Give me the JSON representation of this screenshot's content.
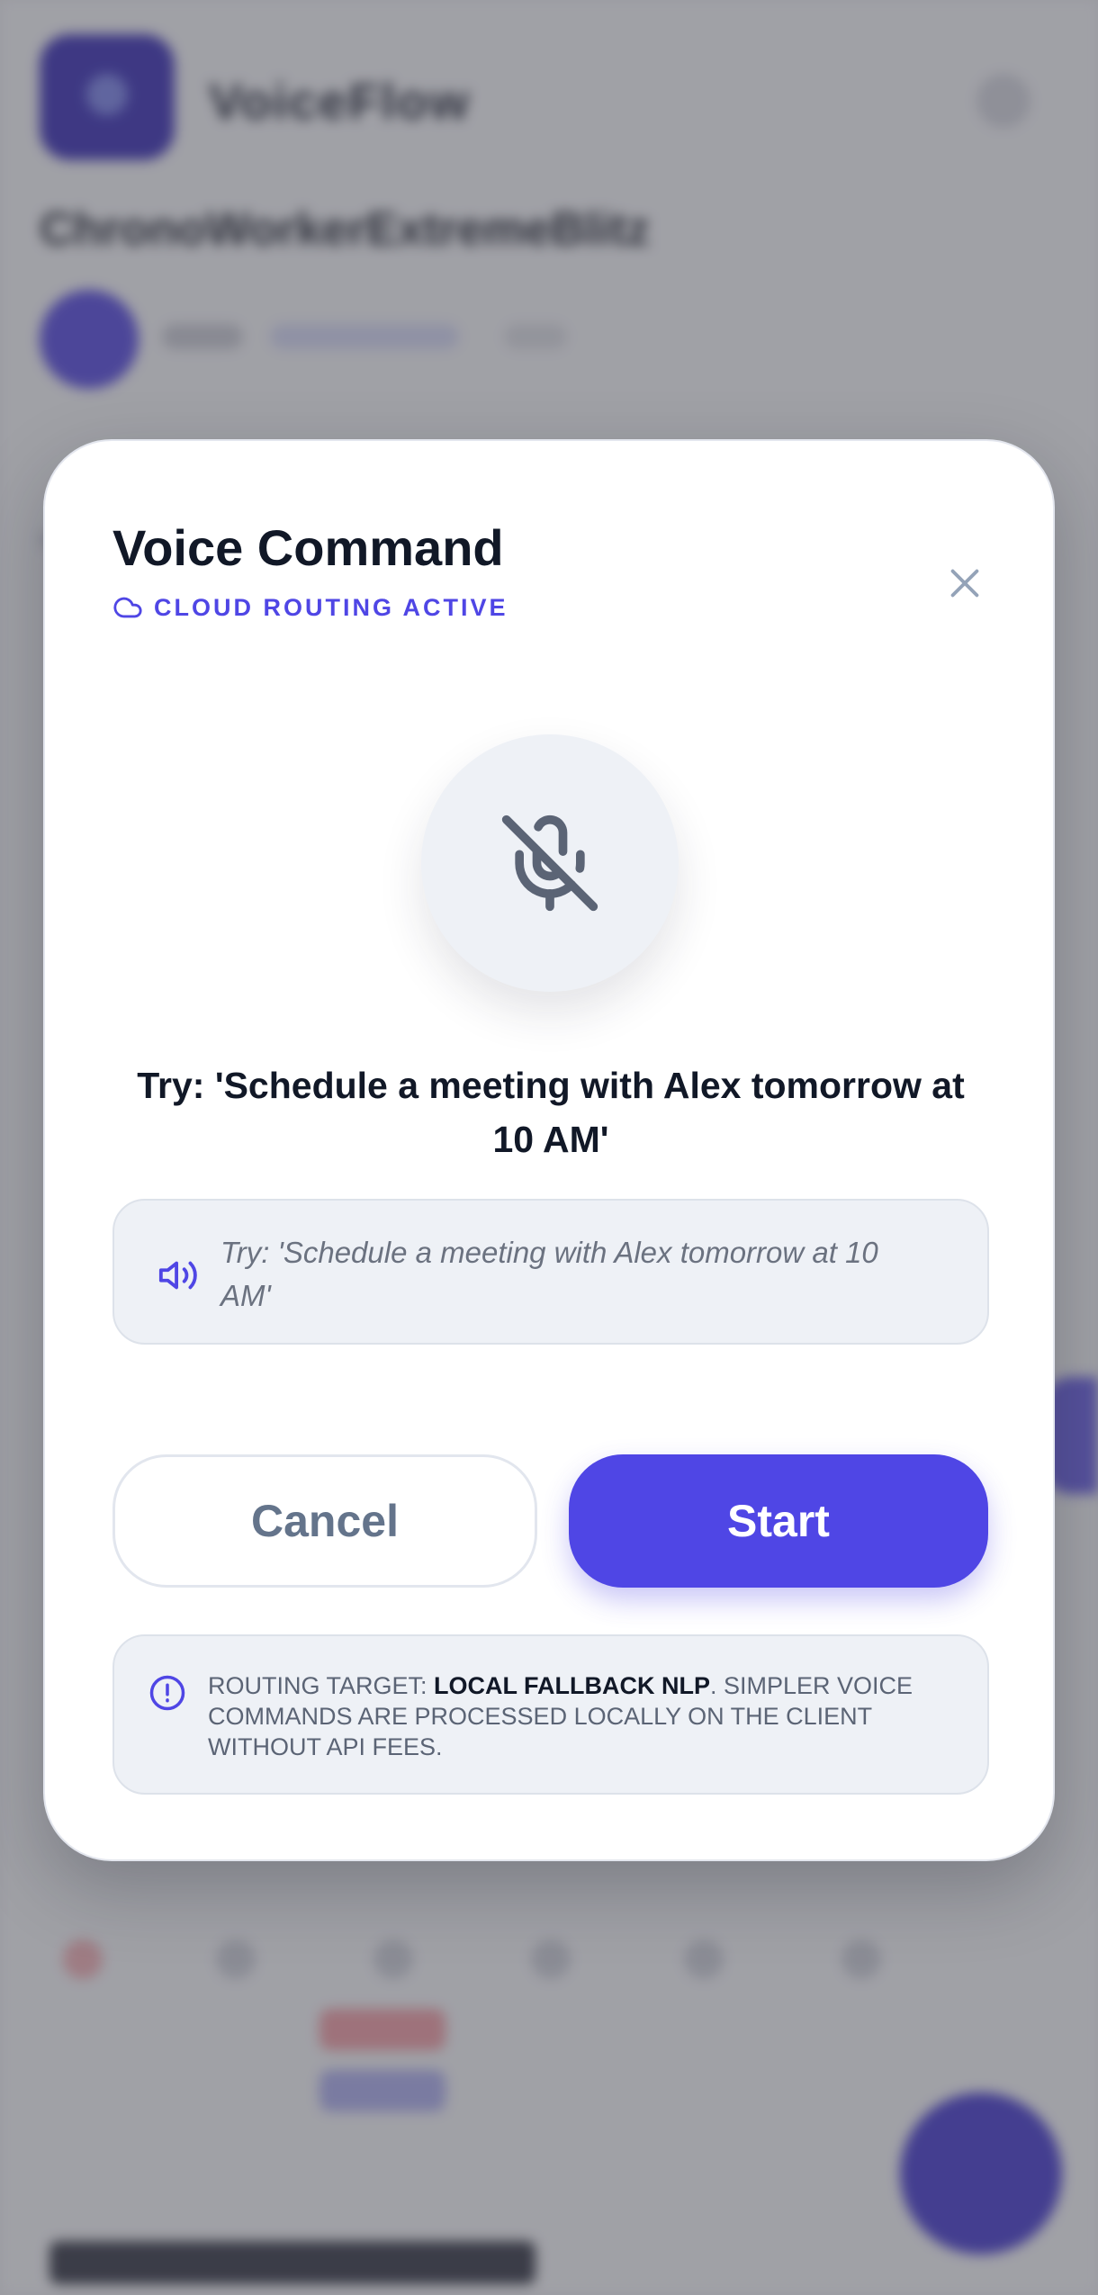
{
  "background": {
    "app_name": "VoiceFlow",
    "page_heading": "ChronoWorkerExtremeBlitz"
  },
  "modal": {
    "title": "Voice Command",
    "status_label": "CLOUD ROUTING ACTIVE",
    "close_icon": "close-icon",
    "mic_icon": "mic-off-icon",
    "mic_state": "muted",
    "prompt": "Try: 'Schedule a meeting with Alex tomorrow at 10 AM'",
    "transcript_placeholder": "Try: 'Schedule a meeting with Alex tomorrow at 10 AM'",
    "cancel_label": "Cancel",
    "start_label": "Start",
    "info": {
      "prefix": "ROUTING TARGET: ",
      "target": "LOCAL FALLBACK NLP",
      "suffix": ". SIMPLER VOICE COMMANDS ARE PROCESSED LOCALLY ON THE CLIENT WITHOUT API FEES."
    }
  },
  "colors": {
    "accent": "#4f46e5",
    "text_dark": "#111827",
    "muted": "#64748b",
    "surface": "#eef1f6"
  }
}
